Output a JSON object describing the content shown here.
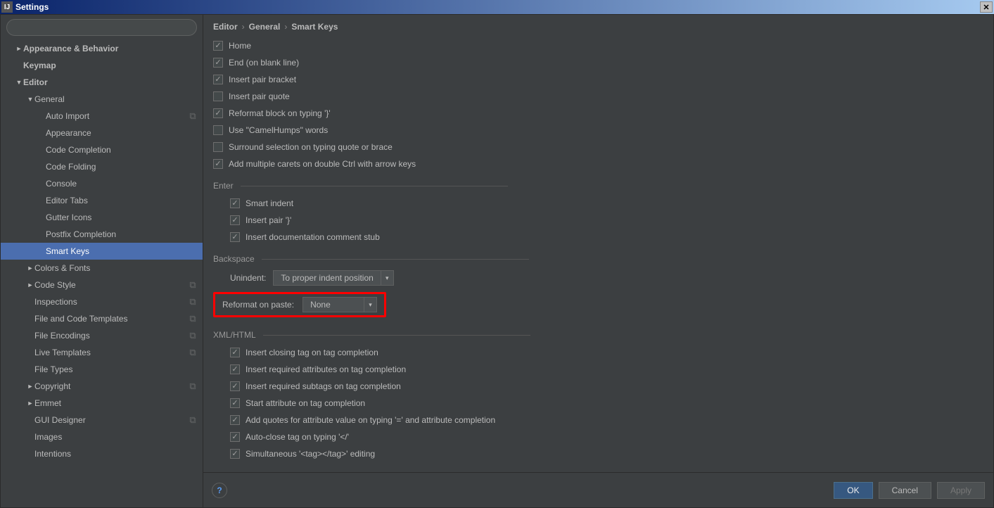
{
  "window": {
    "title": "Settings"
  },
  "breadcrumb": {
    "a": "Editor",
    "b": "General",
    "c": "Smart Keys"
  },
  "sidebar": {
    "items": [
      {
        "label": "Appearance & Behavior",
        "pad": 0,
        "arrow": "►",
        "bold": true
      },
      {
        "label": "Keymap",
        "pad": 0,
        "arrow": "",
        "bold": true
      },
      {
        "label": "Editor",
        "pad": 0,
        "arrow": "▼",
        "bold": true
      },
      {
        "label": "General",
        "pad": 1,
        "arrow": "▼",
        "bold": false
      },
      {
        "label": "Auto Import",
        "pad": 2,
        "arrow": "",
        "copy": true
      },
      {
        "label": "Appearance",
        "pad": 2,
        "arrow": ""
      },
      {
        "label": "Code Completion",
        "pad": 2,
        "arrow": ""
      },
      {
        "label": "Code Folding",
        "pad": 2,
        "arrow": ""
      },
      {
        "label": "Console",
        "pad": 2,
        "arrow": ""
      },
      {
        "label": "Editor Tabs",
        "pad": 2,
        "arrow": ""
      },
      {
        "label": "Gutter Icons",
        "pad": 2,
        "arrow": ""
      },
      {
        "label": "Postfix Completion",
        "pad": 2,
        "arrow": ""
      },
      {
        "label": "Smart Keys",
        "pad": 2,
        "arrow": "",
        "selected": true
      },
      {
        "label": "Colors & Fonts",
        "pad": 1,
        "arrow": "►"
      },
      {
        "label": "Code Style",
        "pad": 1,
        "arrow": "►",
        "copy": true
      },
      {
        "label": "Inspections",
        "pad": 1,
        "arrow": "",
        "copy": true
      },
      {
        "label": "File and Code Templates",
        "pad": 1,
        "arrow": "",
        "copy": true
      },
      {
        "label": "File Encodings",
        "pad": 1,
        "arrow": "",
        "copy": true
      },
      {
        "label": "Live Templates",
        "pad": 1,
        "arrow": "",
        "copy": true
      },
      {
        "label": "File Types",
        "pad": 1,
        "arrow": ""
      },
      {
        "label": "Copyright",
        "pad": 1,
        "arrow": "►",
        "copy": true
      },
      {
        "label": "Emmet",
        "pad": 1,
        "arrow": "►"
      },
      {
        "label": "GUI Designer",
        "pad": 1,
        "arrow": "",
        "copy": true
      },
      {
        "label": "Images",
        "pad": 1,
        "arrow": ""
      },
      {
        "label": "Intentions",
        "pad": 1,
        "arrow": ""
      }
    ]
  },
  "options": {
    "top": [
      {
        "label": "Home",
        "checked": true
      },
      {
        "label": "End (on blank line)",
        "checked": true
      },
      {
        "label": "Insert pair bracket",
        "checked": true
      },
      {
        "label": "Insert pair quote",
        "checked": false
      },
      {
        "label": "Reformat block on typing '}'",
        "checked": true
      },
      {
        "label": "Use \"CamelHumps\" words",
        "checked": false
      },
      {
        "label": "Surround selection on typing quote or brace",
        "checked": false
      },
      {
        "label": "Add multiple carets on double Ctrl with arrow keys",
        "checked": true
      }
    ],
    "enter_title": "Enter",
    "enter": [
      {
        "label": "Smart indent",
        "checked": true
      },
      {
        "label": "Insert pair '}'",
        "checked": true
      },
      {
        "label": "Insert documentation comment stub",
        "checked": true
      }
    ],
    "backspace_title": "Backspace",
    "unindent_label": "Unindent:",
    "unindent_value": "To proper indent position",
    "reformat_label": "Reformat on paste:",
    "reformat_value": "None",
    "xml_title": "XML/HTML",
    "xml": [
      {
        "label": "Insert closing tag on tag completion",
        "checked": true
      },
      {
        "label": "Insert required attributes on tag completion",
        "checked": true
      },
      {
        "label": "Insert required subtags on tag completion",
        "checked": true
      },
      {
        "label": "Start attribute on tag completion",
        "checked": true
      },
      {
        "label": "Add quotes for attribute value on typing '=' and attribute completion",
        "checked": true
      },
      {
        "label": "Auto-close tag on typing '</'",
        "checked": true
      },
      {
        "label": "Simultaneous '<tag></tag>' editing",
        "checked": true
      }
    ]
  },
  "footer": {
    "ok": "OK",
    "cancel": "Cancel",
    "apply": "Apply"
  }
}
